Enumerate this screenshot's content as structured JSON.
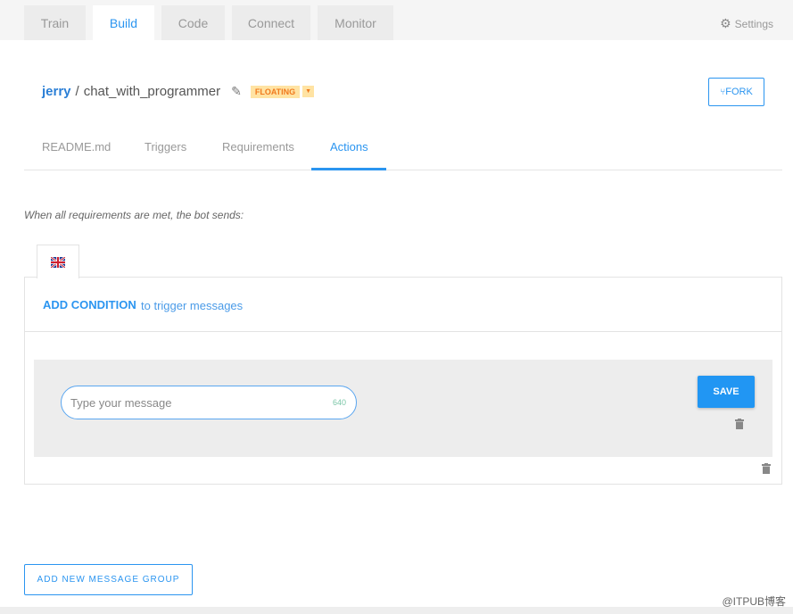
{
  "top_tabs": [
    "Train",
    "Build",
    "Code",
    "Connect",
    "Monitor"
  ],
  "active_top_tab": "Build",
  "settings_label": "Settings",
  "breadcrumb": {
    "user": "jerry",
    "separator": "/",
    "project": "chat_with_programmer"
  },
  "badge": "FLOATING",
  "fork_label": "FORK",
  "sub_tabs": [
    "README.md",
    "Triggers",
    "Requirements",
    "Actions"
  ],
  "active_sub_tab": "Actions",
  "intro": "When all requirements are met, the bot sends:",
  "add_condition": "ADD CONDITION",
  "trigger_text": "to trigger messages",
  "message": {
    "placeholder": "Type your message",
    "value": "",
    "char_count": "640"
  },
  "save_label": "SAVE",
  "add_group_label": "ADD NEW MESSAGE GROUP",
  "watermark": "@ITPUB博客",
  "colors": {
    "accent": "#2196f3",
    "badge_bg": "#ffe3a3",
    "badge_text": "#f07a1e"
  }
}
